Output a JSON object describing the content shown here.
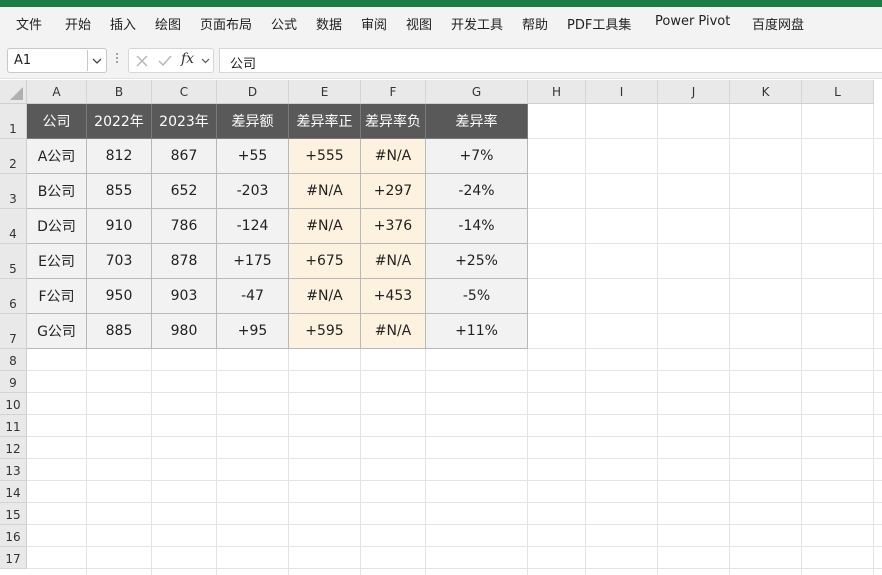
{
  "menu": [
    "文件",
    "开始",
    "插入",
    "绘图",
    "页面布局",
    "公式",
    "数据",
    "审阅",
    "视图",
    "开发工具",
    "帮助",
    "PDF工具集",
    "Power Pivot",
    "百度网盘"
  ],
  "formula_bar": {
    "name_box": "A1",
    "fx_label": "fx",
    "content": "公司"
  },
  "columns": [
    "A",
    "B",
    "C",
    "D",
    "E",
    "F",
    "G",
    "H",
    "I",
    "J",
    "K",
    "L"
  ],
  "rows": [
    "1",
    "2",
    "3",
    "4",
    "5",
    "6",
    "7",
    "8",
    "9",
    "10",
    "11",
    "12",
    "13",
    "14",
    "15",
    "16",
    "17"
  ],
  "table": {
    "headers": [
      "公司",
      "2022年",
      "2023年",
      "差异额",
      "差异率正",
      "差异率负",
      "差异率"
    ],
    "rows": [
      [
        "A公司",
        "812",
        "867",
        "+55",
        "+555",
        "#N/A",
        "+7%"
      ],
      [
        "B公司",
        "855",
        "652",
        "-203",
        "#N/A",
        "+297",
        "-24%"
      ],
      [
        "D公司",
        "910",
        "786",
        "-124",
        "#N/A",
        "+376",
        "-14%"
      ],
      [
        "E公司",
        "703",
        "878",
        "+175",
        "+675",
        "#N/A",
        "+25%"
      ],
      [
        "F公司",
        "950",
        "903",
        "-47",
        "#N/A",
        "+453",
        "-5%"
      ],
      [
        "G公司",
        "885",
        "980",
        "+95",
        "+595",
        "#N/A",
        "+11%"
      ]
    ]
  },
  "colors": {
    "title_bar": "#1e7c45",
    "header_fill": "#595959",
    "highlight_fill": "#fdf2df",
    "cell_fill": "#f2f2f2"
  }
}
